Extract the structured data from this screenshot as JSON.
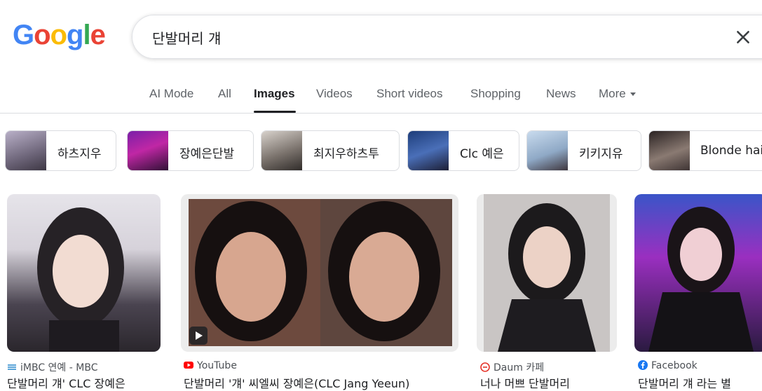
{
  "logo": {
    "letters": [
      "G",
      "o",
      "o",
      "g",
      "l",
      "e"
    ],
    "colors": [
      "#4285F4",
      "#EA4335",
      "#FBBC05",
      "#4285F4",
      "#34A853",
      "#EA4335"
    ]
  },
  "search": {
    "query": "단발머리 걔"
  },
  "tabs": [
    "AI Mode",
    "All",
    "Images",
    "Videos",
    "Short videos",
    "Shopping",
    "News",
    "More"
  ],
  "active_tab": "Images",
  "chips": [
    "하츠지우",
    "장예은단발",
    "최지우하츠투",
    "Clc 예은",
    "키키지유",
    "Blonde hair"
  ],
  "results": [
    {
      "source": "iMBC 연예 - MBC",
      "title": "단발머리 걔' CLC 장예은"
    },
    {
      "source": "YouTube",
      "title": "단발머리 '걔' 씨엘씨 장예은(CLC Jang Yeeun)"
    },
    {
      "source": "Daum 카페",
      "title": "너나 머쁘 단발머리"
    },
    {
      "source": "Facebook",
      "title": "단발머리 걔 라는 별"
    }
  ],
  "colors": {
    "accent": "#1a73e8",
    "youtube": "#ff0000",
    "daum": "#e5352b",
    "facebook": "#1877f2"
  }
}
